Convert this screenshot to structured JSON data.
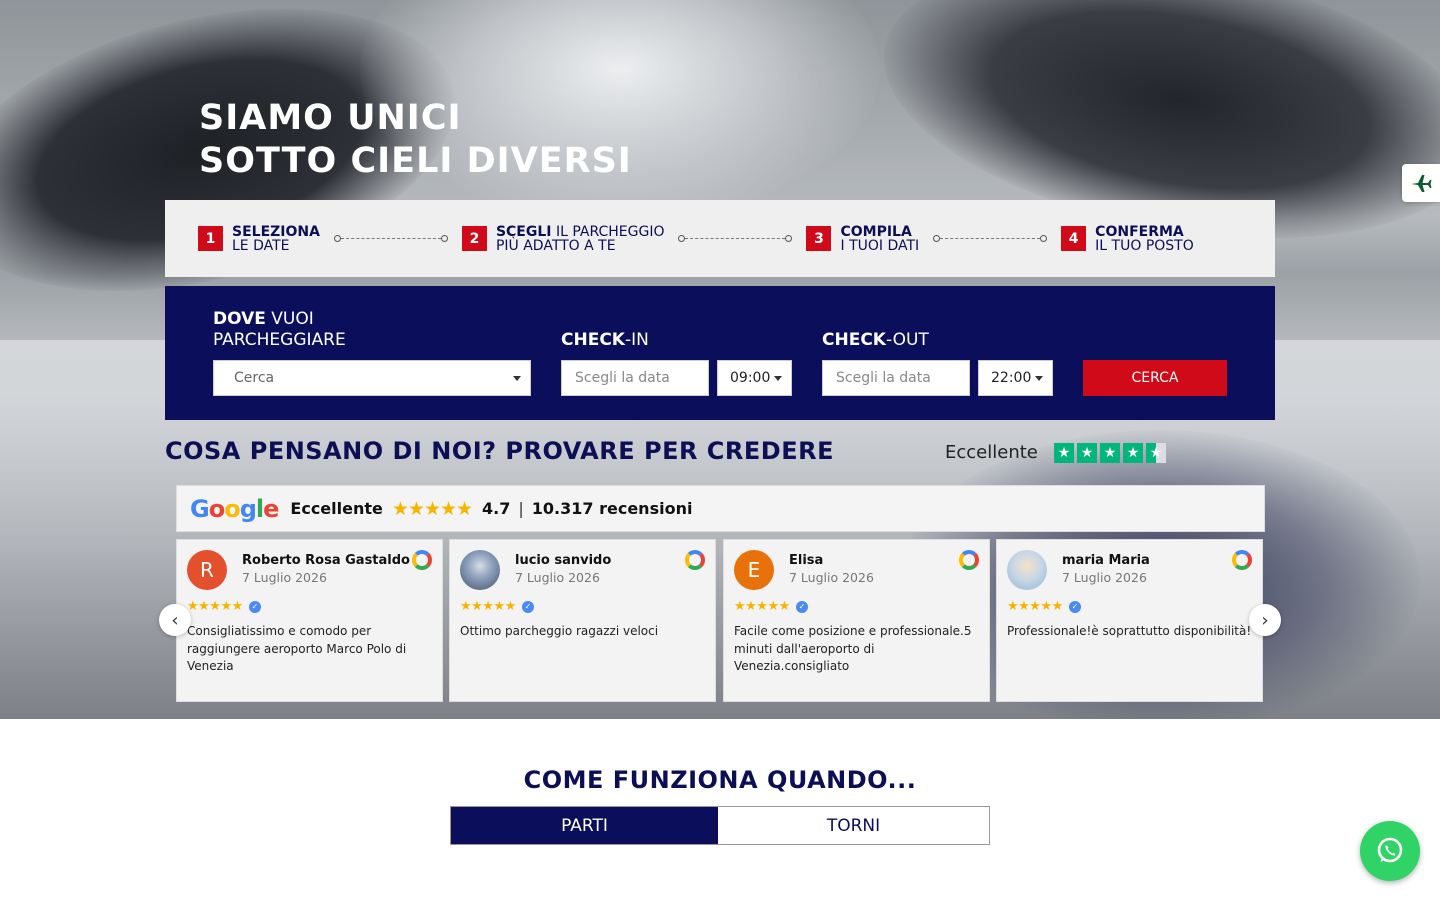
{
  "hero": {
    "title_line1": "SIAMO UNICI",
    "title_line2": "SOTTO CIELI DIVERSI"
  },
  "steps": [
    {
      "num": "1",
      "bold": "SELEZIONA",
      "rest1": "",
      "line2": "LE DATE"
    },
    {
      "num": "2",
      "bold": "SCEGLI",
      "rest1": " IL PARCHEGGIO",
      "line2": "PIÙ ADATTO A TE"
    },
    {
      "num": "3",
      "bold": "COMPILA",
      "rest1": "",
      "line2": "I TUOI DATI"
    },
    {
      "num": "4",
      "bold": "CONFERMA",
      "rest1": "",
      "line2": "IL TUO POSTO"
    }
  ],
  "search": {
    "where_bold": "DOVE",
    "where_rest": " VUOI",
    "where_line2": "PARCHEGGIARE",
    "where_placeholder": "Cerca",
    "checkin_bold": "CHECK",
    "checkin_rest": "-IN",
    "checkin_placeholder": "Scegli la data",
    "checkin_time": "09:00",
    "checkout_bold": "CHECK",
    "checkout_rest": "-OUT",
    "checkout_placeholder": "Scegli la data",
    "checkout_time": "22:00",
    "button": "CERCA"
  },
  "reviews": {
    "title": "COSA PENSANO DI NOI? PROVARE PER CREDERE",
    "trustpilot_label": "Eccellente",
    "trustpilot_rating": 4.5,
    "google": {
      "logo": [
        "G",
        "o",
        "o",
        "g",
        "l",
        "e"
      ],
      "label": "Eccellente",
      "stars": "★★★★★",
      "rating": "4.7",
      "separator": "|",
      "count": "10.317 recensioni"
    },
    "items": [
      {
        "name": "Roberto Rosa Gastaldo",
        "date": "7 Luglio 2026",
        "initial": "R",
        "avatar_color": "#e4502b",
        "stars": "★★★★★",
        "text": "Consigliatissimo e comodo per raggiungere aeroporto Marco Polo di Venezia"
      },
      {
        "name": "lucio sanvido",
        "date": "7 Luglio 2026",
        "initial": "",
        "avatar_color": "#5b6d8c",
        "stars": "★★★★★",
        "text": "Ottimo parcheggio ragazzi veloci"
      },
      {
        "name": "Elisa",
        "date": "7 Luglio 2026",
        "initial": "E",
        "avatar_color": "#e8710a",
        "stars": "★★★★★",
        "text": "Facile come posizione e professionale.5 minuti dall'aeroporto di Venezia.consigliato"
      },
      {
        "name": "maria Maria",
        "date": "7 Luglio 2026",
        "initial": "",
        "avatar_color": "#b9c8d8",
        "stars": "★★★★★",
        "text": "Professionale!è soprattutto disponibilità!"
      }
    ]
  },
  "how": {
    "title": "COME FUNZIONA QUANDO...",
    "tab_active": "PARTI",
    "tab_inactive": "TORNI"
  },
  "colors": {
    "navy": "#0b0e5a",
    "red": "#d10a1a",
    "whatsapp": "#2fd366",
    "trustpilot": "#00b67a"
  },
  "icons": {
    "side_widget": "plane-icon",
    "chat": "whatsapp-icon"
  }
}
